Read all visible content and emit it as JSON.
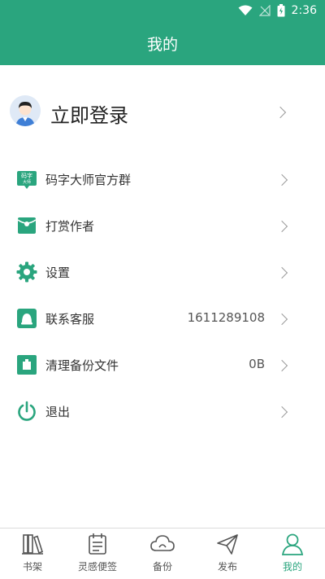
{
  "status_bar": {
    "time": "2:36"
  },
  "header": {
    "title": "我的"
  },
  "login": {
    "label": "立即登录"
  },
  "menu": [
    {
      "label": "码字大师官方群",
      "value": ""
    },
    {
      "label": "打赏作者",
      "value": ""
    },
    {
      "label": "设置",
      "value": ""
    },
    {
      "label": "联系客服",
      "value": "1611289108"
    },
    {
      "label": "清理备份文件",
      "value": "0B"
    },
    {
      "label": "退出",
      "value": ""
    }
  ],
  "icon_group_text": {
    "line1": "码字",
    "line2": "大师"
  },
  "bottom_nav": [
    {
      "label": "书架",
      "icon": "bookshelf-icon",
      "active": false
    },
    {
      "label": "灵感便签",
      "icon": "notes-icon",
      "active": false
    },
    {
      "label": "备份",
      "icon": "cloud-icon",
      "active": false
    },
    {
      "label": "发布",
      "icon": "send-icon",
      "active": false
    },
    {
      "label": "我的",
      "icon": "profile-icon",
      "active": true
    }
  ],
  "colors": {
    "primary": "#2aa57e",
    "text": "#333333",
    "chevron": "#9a9a9a"
  }
}
